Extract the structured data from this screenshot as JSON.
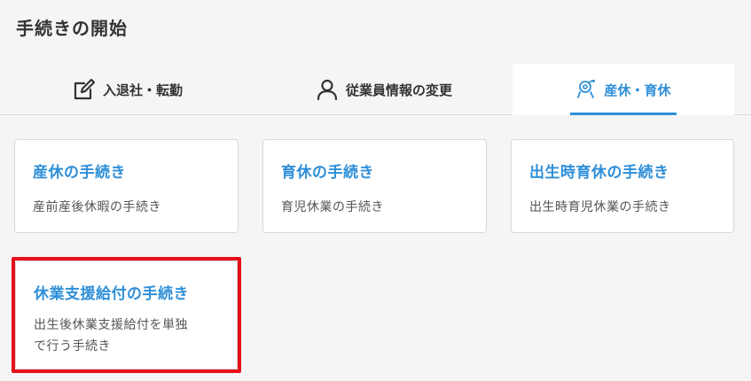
{
  "header": {
    "title": "手続きの開始"
  },
  "tabs": [
    {
      "label": "入退社・転勤",
      "icon": "edit-icon",
      "active": false
    },
    {
      "label": "従業員情報の変更",
      "icon": "person-icon",
      "active": false
    },
    {
      "label": "産休・育休",
      "icon": "maternity-icon",
      "active": true
    }
  ],
  "cards": [
    {
      "title": "産休の手続き",
      "description": "産前産後休暇の手続き"
    },
    {
      "title": "育休の手続き",
      "description": "育児休業の手続き"
    },
    {
      "title": "出生時育休の手続き",
      "description": "出生時育児休業の手続き"
    },
    {
      "title": "休業支援給付の手続き",
      "description_lines": [
        "出生後休業支援給付を単独",
        "で行う手続き"
      ]
    }
  ],
  "colors": {
    "accent": "#2f8fd8",
    "highlight": "#e8101a"
  }
}
